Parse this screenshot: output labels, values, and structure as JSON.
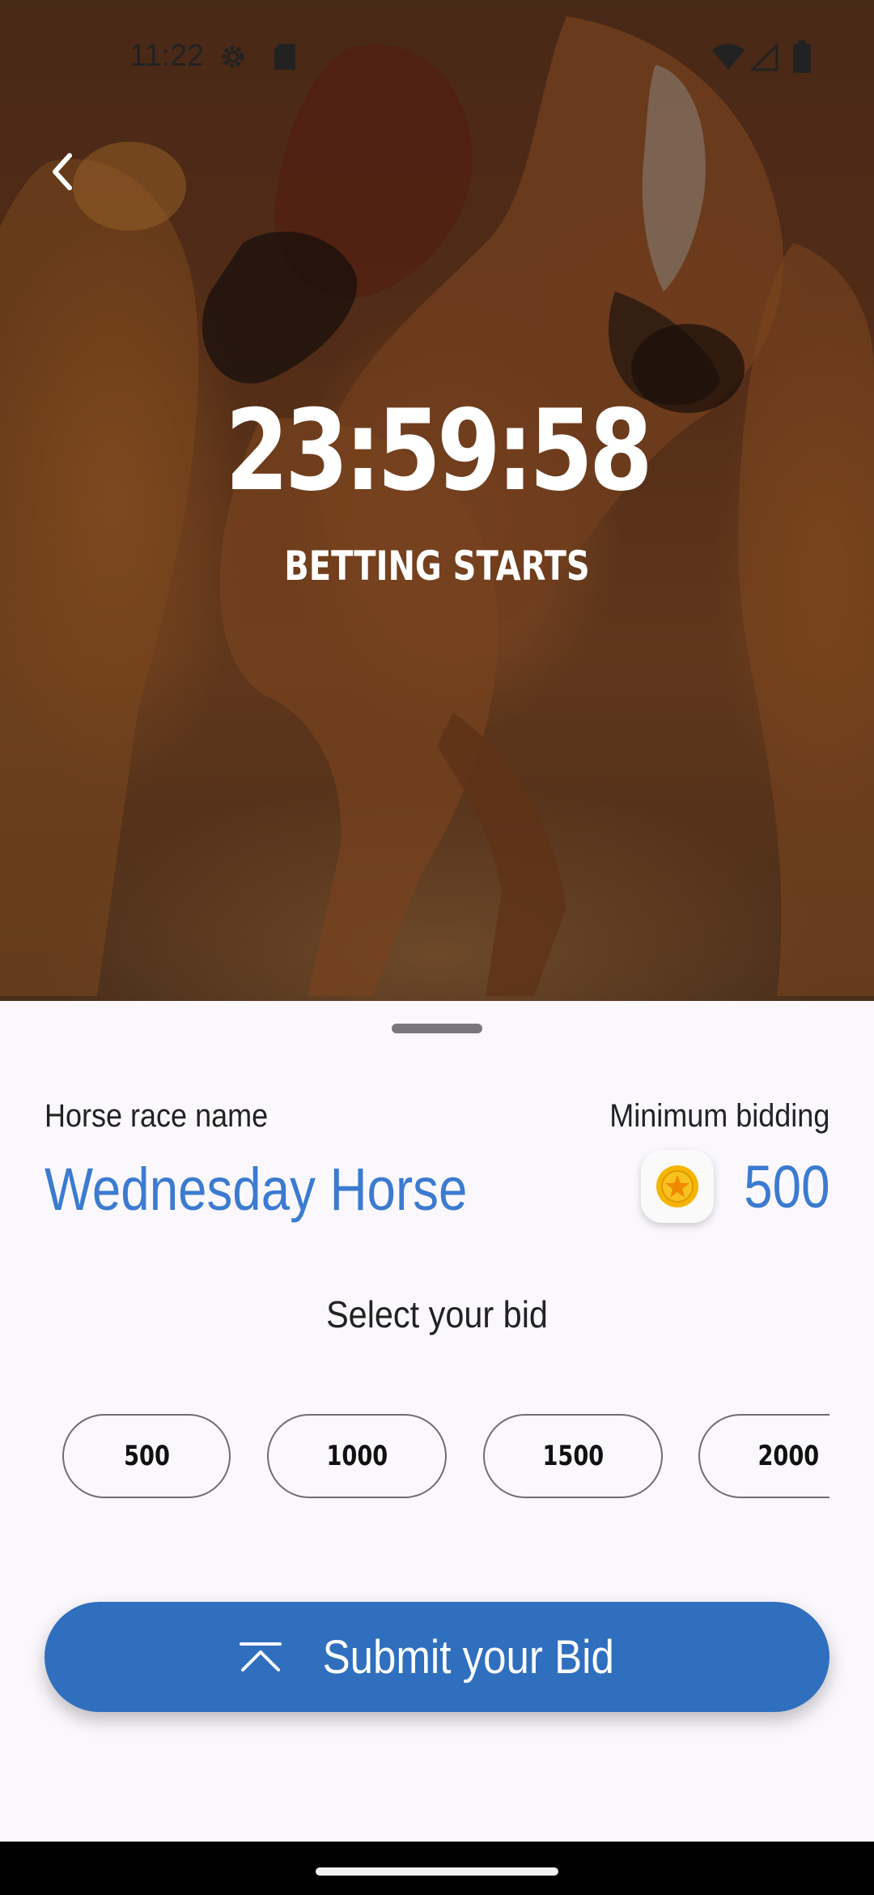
{
  "status_bar": {
    "time": "11:22"
  },
  "hero": {
    "countdown": "23:59:58",
    "countdown_label": "BETTING STARTS"
  },
  "race": {
    "name_label": "Horse race name",
    "name": "Wednesday Horse",
    "min_label": "Minimum bidding",
    "min_value": "500"
  },
  "bids": {
    "title": "Select your bid",
    "options": [
      "500",
      "1000",
      "1500",
      "2000"
    ]
  },
  "submit": {
    "label": "Submit your Bid"
  },
  "colors": {
    "accent": "#3b7bd0",
    "button": "#2f6fbd",
    "coin": "#f5b400"
  },
  "icons": {
    "back": "chevron-left-icon",
    "coin": "coin-star-icon",
    "submit": "chevron-up-bar-icon"
  }
}
